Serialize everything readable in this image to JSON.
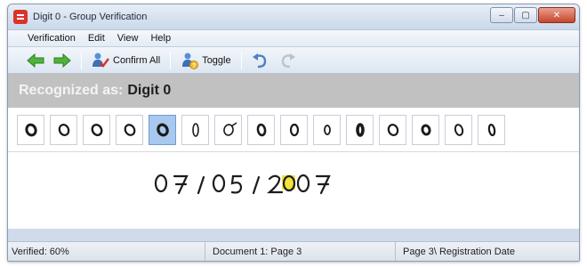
{
  "window": {
    "title": "Digit 0 - Group Verification",
    "minimize_symbol": "–",
    "maximize_symbol": "▢",
    "close_symbol": "✕"
  },
  "menu": {
    "items": [
      "Verification",
      "Edit",
      "View",
      "Help"
    ]
  },
  "toolbar": {
    "back_icon": "green-left-arrow",
    "forward_icon": "green-right-arrow",
    "confirm_all_label": "Confirm All",
    "toggle_label": "Toggle",
    "undo_icon": "undo-arrow",
    "redo_icon": "redo-arrow"
  },
  "heading": {
    "prefix": "Recognized as:",
    "value": "Digit 0"
  },
  "samples": {
    "count": 15,
    "selected_index": 4
  },
  "preview": {
    "field_text": "07 / 05 / 2007",
    "highlight_color": "#f2e23c"
  },
  "status": {
    "verified": "Verified: 60%",
    "document": "Document 1: Page 3",
    "field": "Page 3\\ Registration Date"
  }
}
